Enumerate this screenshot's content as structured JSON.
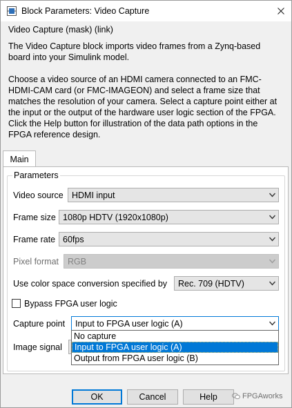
{
  "window": {
    "title": "Block Parameters: Video Capture"
  },
  "mask": {
    "title": "Video Capture (mask) (link)",
    "description_1": "The Video Capture block imports video frames from a Zynq-based board into your Simulink model.",
    "description_2": "Choose a video source of an HDMI camera connected to an FMC-HDMI-CAM card (or FMC-IMAGEON) and select a frame size that matches the resolution of your camera. Select a capture point either at the input or the output of the hardware user logic section of the FPGA. Click the Help button for illustration of the data path options in the FPGA reference design."
  },
  "tabs": [
    {
      "label": "Main",
      "active": true
    }
  ],
  "parameters": {
    "legend": "Parameters",
    "video_source": {
      "label": "Video source",
      "value": "HDMI input"
    },
    "frame_size": {
      "label": "Frame size",
      "value": "1080p HDTV (1920x1080p)"
    },
    "frame_rate": {
      "label": "Frame rate",
      "value": "60fps"
    },
    "pixel_format": {
      "label": "Pixel format",
      "value": "RGB",
      "enabled": false
    },
    "color_space": {
      "label": "Use color space conversion specified by",
      "value": "Rec. 709 (HDTV)"
    },
    "bypass": {
      "label": "Bypass FPGA user logic",
      "checked": false
    },
    "capture_point": {
      "label": "Capture point",
      "value": "Input to FPGA user logic (A)",
      "options": [
        "No capture",
        "Input to FPGA user logic (A)",
        "Output from FPGA user logic (B)"
      ],
      "selected_index": 1
    },
    "image_signal": {
      "label": "Image signal"
    }
  },
  "buttons": {
    "ok": "OK",
    "cancel": "Cancel",
    "help": "Help"
  },
  "watermark": {
    "text": "FPGAworks"
  },
  "colors": {
    "accent": "#0078d7",
    "window_bg": "#f0f0f0"
  }
}
